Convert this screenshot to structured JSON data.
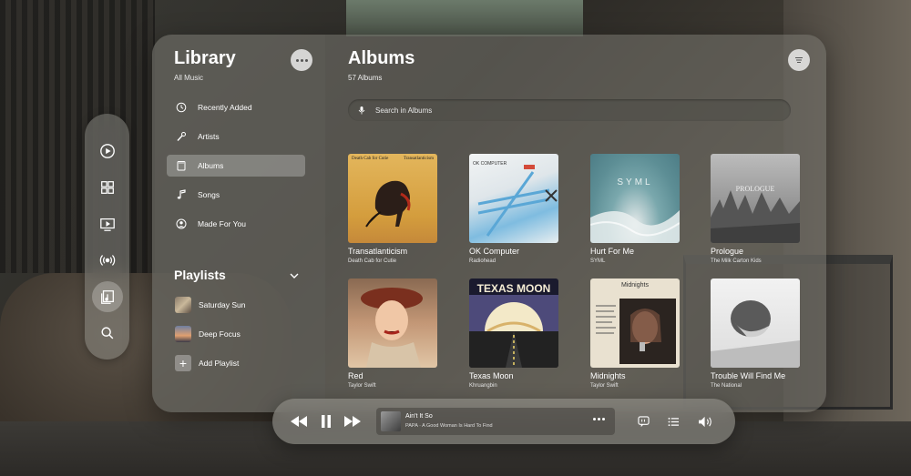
{
  "sidebar": {
    "title": "Library",
    "subtitle": "All Music",
    "items": [
      {
        "label": "Recently Added",
        "icon": "clock-icon"
      },
      {
        "label": "Artists",
        "icon": "microphone-icon"
      },
      {
        "label": "Albums",
        "icon": "album-icon",
        "active": true
      },
      {
        "label": "Songs",
        "icon": "music-note-icon"
      },
      {
        "label": "Made For You",
        "icon": "person-icon"
      }
    ],
    "playlists_title": "Playlists",
    "playlists": [
      {
        "label": "Saturday Sun"
      },
      {
        "label": "Deep Focus"
      },
      {
        "label": "Add Playlist"
      }
    ]
  },
  "main": {
    "title": "Albums",
    "subtitle": "57 Albums",
    "search_placeholder": "Search in Albums",
    "albums": [
      {
        "title": "Transatlanticism",
        "artist": "Death Cab for Cutie",
        "cover_text_left": "Death Cab for Cutie",
        "cover_text_right": "Transatlanticism"
      },
      {
        "title": "OK Computer",
        "artist": "Radiohead",
        "cover_text": "OK COMPUTER"
      },
      {
        "title": "Hurt For Me",
        "artist": "SYML",
        "cover_text": "SYML"
      },
      {
        "title": "Prologue",
        "artist": "The Milk Carton Kids",
        "cover_text": "PROLOGUE"
      },
      {
        "title": "Red",
        "artist": "Taylor Swift"
      },
      {
        "title": "Texas Moon",
        "artist": "Khruangbin",
        "cover_text": "TEXAS MOON"
      },
      {
        "title": "Midnights",
        "artist": "Taylor Swift",
        "cover_text": "Midnights"
      },
      {
        "title": "Trouble Will Find Me",
        "artist": "The National"
      }
    ]
  },
  "player": {
    "track": "Ain't It So",
    "subtitle": "PAPA  ·  A Good Woman Is Hard To Find"
  },
  "rail": {
    "icons": [
      "play-circle-icon",
      "grid-icon",
      "tv-icon",
      "broadcast-icon",
      "library-icon",
      "search-icon"
    ]
  }
}
